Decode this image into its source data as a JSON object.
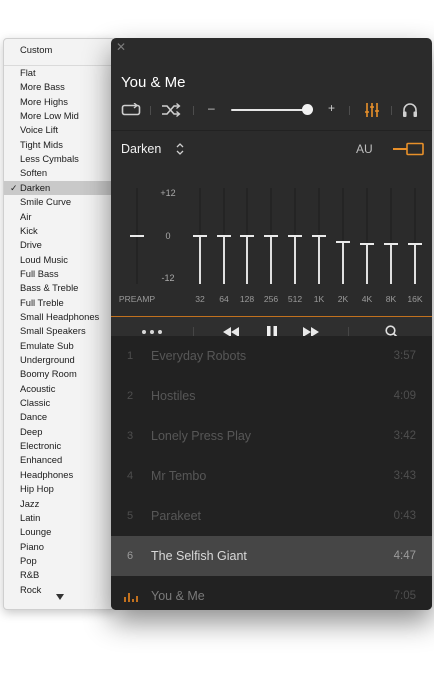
{
  "preset_menu": {
    "items": [
      {
        "label": "Custom",
        "selected": false
      },
      {
        "label": "Flat",
        "selected": false
      },
      {
        "label": "More Bass",
        "selected": false
      },
      {
        "label": "More Highs",
        "selected": false
      },
      {
        "label": "More Low Mid",
        "selected": false
      },
      {
        "label": "Voice Lift",
        "selected": false
      },
      {
        "label": "Tight Mids",
        "selected": false
      },
      {
        "label": "Less Cymbals",
        "selected": false
      },
      {
        "label": "Soften",
        "selected": false
      },
      {
        "label": "Darken",
        "selected": true
      },
      {
        "label": "Smile Curve",
        "selected": false
      },
      {
        "label": "Air",
        "selected": false
      },
      {
        "label": "Kick",
        "selected": false
      },
      {
        "label": "Drive",
        "selected": false
      },
      {
        "label": "Loud Music",
        "selected": false
      },
      {
        "label": "Full Bass",
        "selected": false
      },
      {
        "label": "Bass & Treble",
        "selected": false
      },
      {
        "label": "Full Treble",
        "selected": false
      },
      {
        "label": "Small Headphones",
        "selected": false
      },
      {
        "label": "Small Speakers",
        "selected": false
      },
      {
        "label": "Emulate Sub",
        "selected": false
      },
      {
        "label": "Underground",
        "selected": false
      },
      {
        "label": "Boomy Room",
        "selected": false
      },
      {
        "label": "Acoustic",
        "selected": false
      },
      {
        "label": "Classic",
        "selected": false
      },
      {
        "label": "Dance",
        "selected": false
      },
      {
        "label": "Deep",
        "selected": false
      },
      {
        "label": "Electronic",
        "selected": false
      },
      {
        "label": "Enhanced",
        "selected": false
      },
      {
        "label": "Headphones",
        "selected": false
      },
      {
        "label": "Hip Hop",
        "selected": false
      },
      {
        "label": "Jazz",
        "selected": false
      },
      {
        "label": "Latin",
        "selected": false
      },
      {
        "label": "Lounge",
        "selected": false
      },
      {
        "label": "Piano",
        "selected": false
      },
      {
        "label": "Pop",
        "selected": false
      },
      {
        "label": "R&B",
        "selected": false
      },
      {
        "label": "Rock",
        "selected": false
      }
    ],
    "check_mark": "✓",
    "more_icon": "chevron-down-icon"
  },
  "player": {
    "close_icon": "close-icon",
    "now_playing_title": "You & Me",
    "controls": {
      "repeat_icon": "repeat-icon",
      "shuffle_icon": "shuffle-icon",
      "volume_minus": "–",
      "volume_plus": "+",
      "volume_level": 0.93,
      "equalizer_icon": "equalizer-icon",
      "output_icon": "headphones-icon"
    },
    "equalizer": {
      "preset": "Darken",
      "au_label": "AU",
      "enabled": true,
      "db_labels": {
        "top": "+12",
        "mid": "0",
        "bottom": "-12"
      },
      "preamp": {
        "label": "PREAMP",
        "gain_db": 0
      },
      "bands": [
        {
          "label": "32",
          "gain_db": 0
        },
        {
          "label": "64",
          "gain_db": 0
        },
        {
          "label": "128",
          "gain_db": 0
        },
        {
          "label": "256",
          "gain_db": 0
        },
        {
          "label": "512",
          "gain_db": 0
        },
        {
          "label": "1K",
          "gain_db": 0
        },
        {
          "label": "2K",
          "gain_db": -1.5
        },
        {
          "label": "4K",
          "gain_db": -2
        },
        {
          "label": "8K",
          "gain_db": -2
        },
        {
          "label": "16K",
          "gain_db": -2
        }
      ],
      "colors": {
        "accent": "#e8902a"
      }
    },
    "transport": {
      "more_icon": "more-dots-icon",
      "prev_icon": "rewind-icon",
      "pause_icon": "pause-icon",
      "next_icon": "fast-forward-icon",
      "search_icon": "search-icon"
    },
    "tracks": [
      {
        "num": "1",
        "title": "Everyday Robots",
        "duration": "3:57",
        "state": "normal"
      },
      {
        "num": "2",
        "title": "Hostiles",
        "duration": "4:09",
        "state": "normal"
      },
      {
        "num": "3",
        "title": "Lonely Press Play",
        "duration": "3:42",
        "state": "normal"
      },
      {
        "num": "4",
        "title": "Mr Tembo",
        "duration": "3:43",
        "state": "normal"
      },
      {
        "num": "5",
        "title": "Parakeet",
        "duration": "0:43",
        "state": "normal"
      },
      {
        "num": "6",
        "title": "The Selfish Giant",
        "duration": "4:47",
        "state": "highlighted"
      },
      {
        "num": "",
        "title": "You & Me",
        "duration": "7:05",
        "state": "current"
      }
    ]
  }
}
